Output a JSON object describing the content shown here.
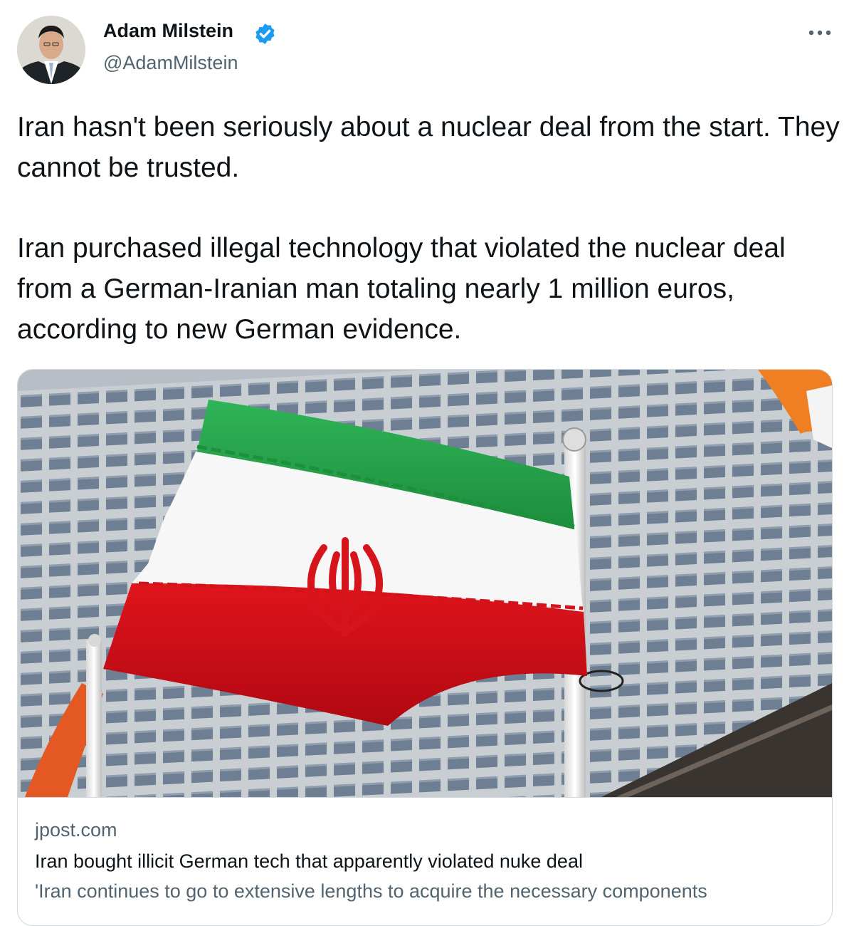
{
  "author": {
    "display_name": "Adam Milstein",
    "handle": "@AdamMilstein",
    "verified_icon": "verified-badge-icon",
    "avatar_icon": "avatar-photo"
  },
  "menu": {
    "more_icon": "more-options-icon"
  },
  "tweet": {
    "paragraphs": [
      "Iran hasn't been seriously about a nuclear deal from the start. They cannot be trusted.",
      "Iran purchased illegal technology that violated the nuclear deal from a German-Iranian man totaling nearly 1 million euros, according to new German evidence."
    ]
  },
  "link_card": {
    "image_icon": "iran-flag-photo",
    "domain": "jpost.com",
    "title": "Iran bought illicit German tech that apparently violated nuke deal",
    "description": "'Iran continues to go to extensive lengths to acquire the necessary components"
  },
  "colors": {
    "text_primary": "#0f1419",
    "text_secondary": "#536471",
    "verified_blue": "#1d9bf0",
    "card_border": "#cfd9de",
    "flag_green": "#239f40",
    "flag_white": "#ffffff",
    "flag_red": "#da0000"
  }
}
